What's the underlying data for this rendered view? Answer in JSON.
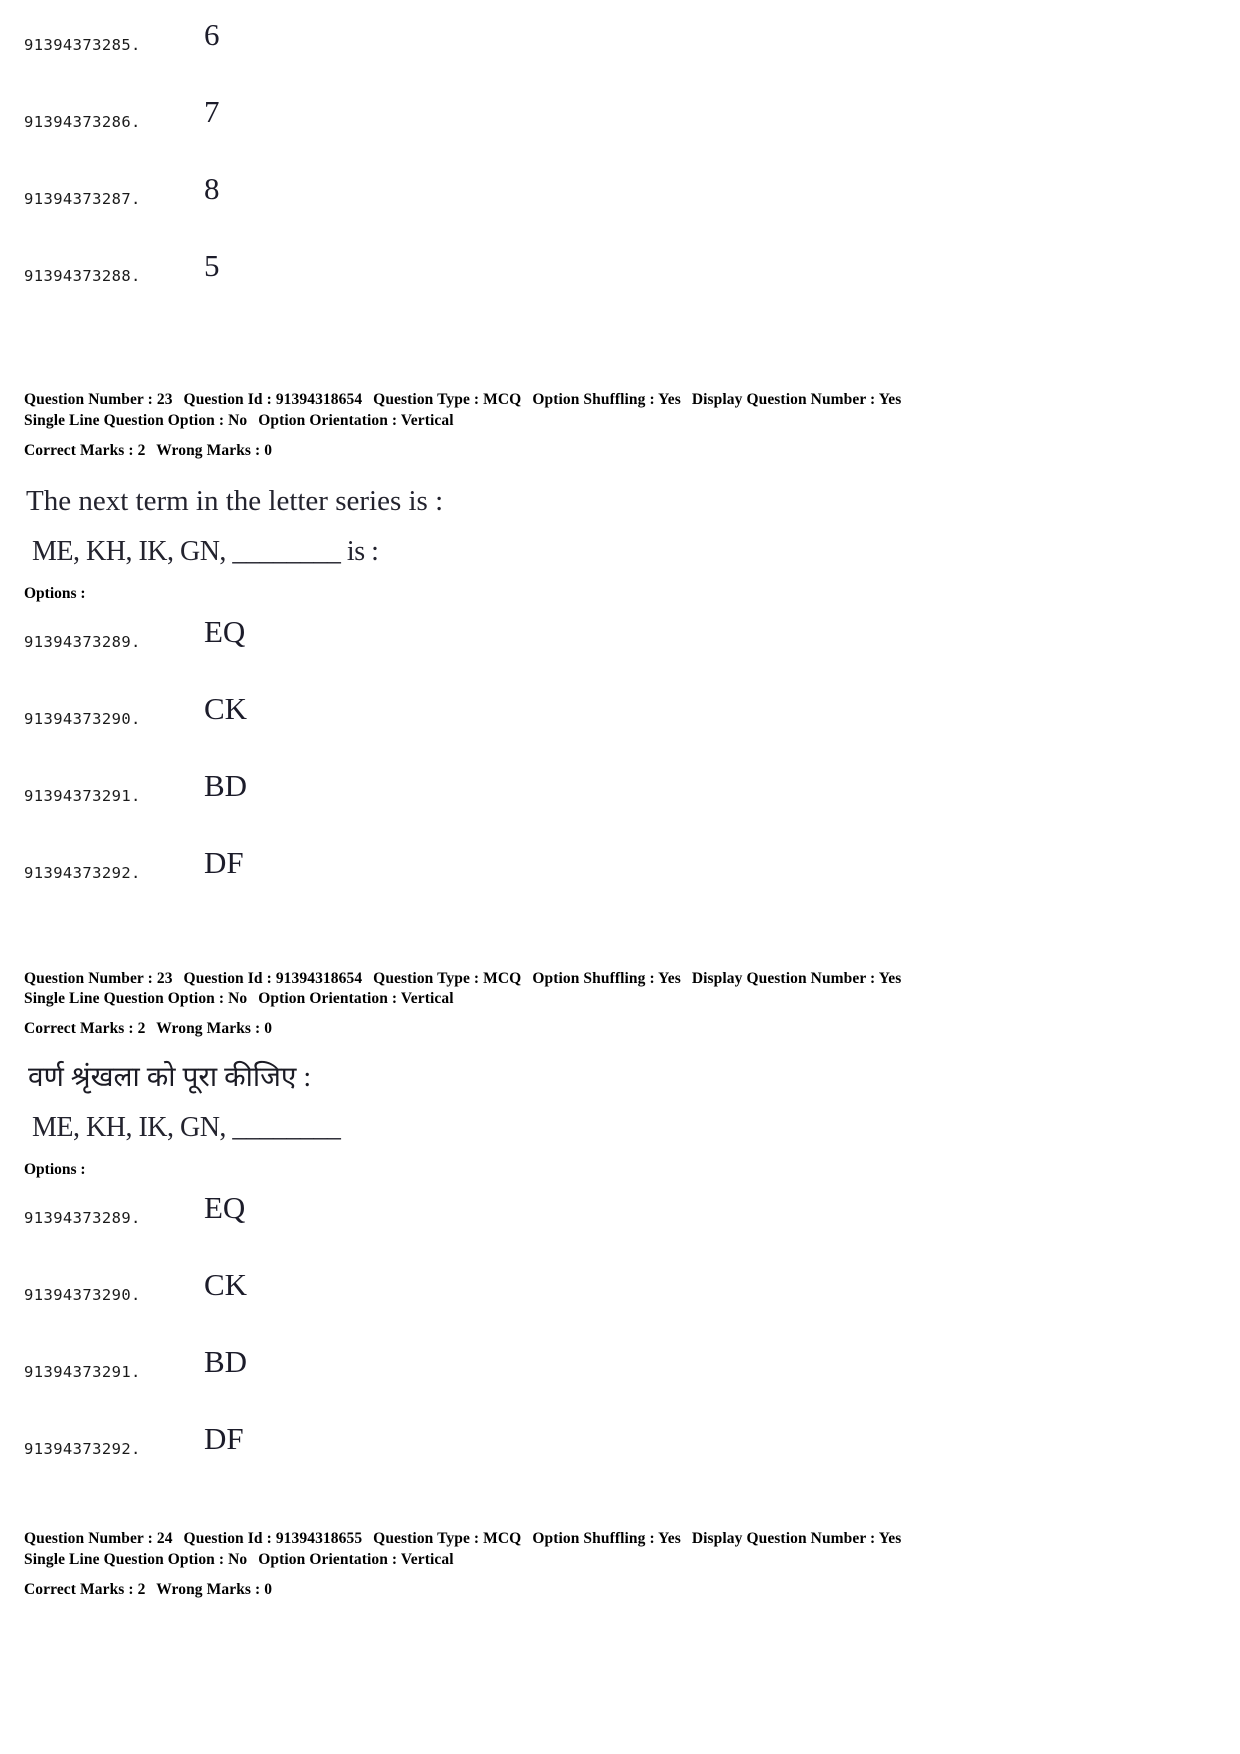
{
  "top_options": [
    {
      "id": "91394373285.",
      "text": "6"
    },
    {
      "id": "91394373286.",
      "text": "7"
    },
    {
      "id": "91394373287.",
      "text": "8"
    },
    {
      "id": "91394373288.",
      "text": "5"
    }
  ],
  "question_en": {
    "meta": {
      "question_number_label": "Question Number :",
      "question_number": "23",
      "question_id_label": "Question Id :",
      "question_id": "91394318654",
      "question_type_label": "Question Type :",
      "question_type": "MCQ",
      "option_shuffling_label": "Option Shuffling :",
      "option_shuffling": "Yes",
      "display_question_number_label": "Display Question Number :",
      "display_question_number": "Yes",
      "single_line_label": "Single Line Question Option :",
      "single_line": "No",
      "option_orientation_label": "Option Orientation :",
      "option_orientation": "Vertical",
      "correct_marks_label": "Correct Marks :",
      "correct_marks": "2",
      "wrong_marks_label": "Wrong Marks :",
      "wrong_marks": "0"
    },
    "stem_line1": "The next term in the letter series is :",
    "stem_line2": "ME, KH, IK, GN, ________ is :",
    "options_label": "Options :",
    "options": [
      {
        "id": "91394373289.",
        "text": "EQ"
      },
      {
        "id": "91394373290.",
        "text": "CK"
      },
      {
        "id": "91394373291.",
        "text": "BD"
      },
      {
        "id": "91394373292.",
        "text": "DF"
      }
    ]
  },
  "question_hi": {
    "meta": {
      "question_number_label": "Question Number :",
      "question_number": "23",
      "question_id_label": "Question Id :",
      "question_id": "91394318654",
      "question_type_label": "Question Type :",
      "question_type": "MCQ",
      "option_shuffling_label": "Option Shuffling :",
      "option_shuffling": "Yes",
      "display_question_number_label": "Display Question Number :",
      "display_question_number": "Yes",
      "single_line_label": "Single Line Question Option :",
      "single_line": "No",
      "option_orientation_label": "Option Orientation :",
      "option_orientation": "Vertical",
      "correct_marks_label": "Correct Marks :",
      "correct_marks": "2",
      "wrong_marks_label": "Wrong Marks :",
      "wrong_marks": "0"
    },
    "stem_line1": "वर्ण श्रृंखला को पूरा कीजिए :",
    "stem_line2": "ME, KH, IK, GN, ________",
    "options_label": "Options :",
    "options": [
      {
        "id": "91394373289.",
        "text": "EQ"
      },
      {
        "id": "91394373290.",
        "text": "CK"
      },
      {
        "id": "91394373291.",
        "text": "BD"
      },
      {
        "id": "91394373292.",
        "text": "DF"
      }
    ]
  },
  "question_next": {
    "meta": {
      "question_number_label": "Question Number :",
      "question_number": "24",
      "question_id_label": "Question Id :",
      "question_id": "91394318655",
      "question_type_label": "Question Type :",
      "question_type": "MCQ",
      "option_shuffling_label": "Option Shuffling :",
      "option_shuffling": "Yes",
      "display_question_number_label": "Display Question Number :",
      "display_question_number": "Yes",
      "single_line_label": "Single Line Question Option :",
      "single_line": "No",
      "option_orientation_label": "Option Orientation :",
      "option_orientation": "Vertical",
      "correct_marks_label": "Correct Marks :",
      "correct_marks": "2",
      "wrong_marks_label": "Wrong Marks :",
      "wrong_marks": "0"
    }
  }
}
